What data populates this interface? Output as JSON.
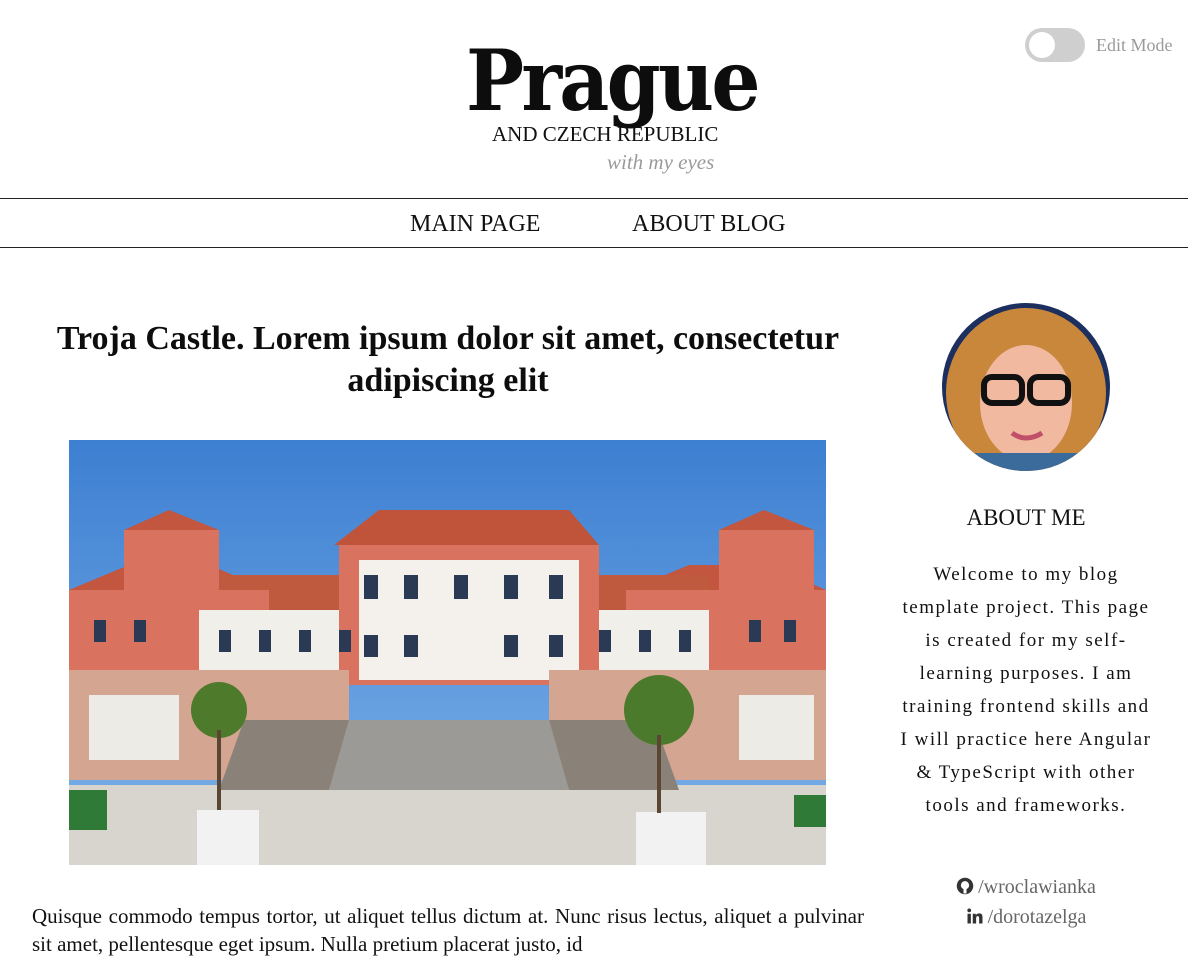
{
  "header": {
    "title": "Prague",
    "subtitle": "AND CZECH REPUBLIC",
    "tagline": "with my eyes",
    "edit_mode_label": "Edit Mode",
    "edit_mode_on": false
  },
  "nav": {
    "items": [
      {
        "label": "MAIN PAGE"
      },
      {
        "label": "ABOUT BLOG"
      }
    ]
  },
  "article": {
    "title": "Troja Castle. Lorem ipsum dolor sit amet, consectetur adipiscing elit",
    "image_icon": "castle-photo",
    "text": "Quisque commodo tempus tortor, ut aliquet tellus dictum at. Nunc risus lectus, aliquet a pulvinar sit amet, pellentesque eget ipsum. Nulla pretium placerat justo, id"
  },
  "sidebar": {
    "avatar_icon": "avatar-photo",
    "about_heading": "ABOUT ME",
    "about_text": "Welcome to my blog template project. This page is created for my self-learning purposes. I am training frontend skills and I will practice here Angular & TypeScript with other tools and frameworks.",
    "social": [
      {
        "icon": "github-icon",
        "handle": "/wroclawianka"
      },
      {
        "icon": "linkedin-icon",
        "handle": "/dorotazelga"
      }
    ]
  },
  "colors": {
    "toggle_track": "#cfcfcf",
    "muted_text": "#9a9a9a",
    "rule": "#222222"
  }
}
